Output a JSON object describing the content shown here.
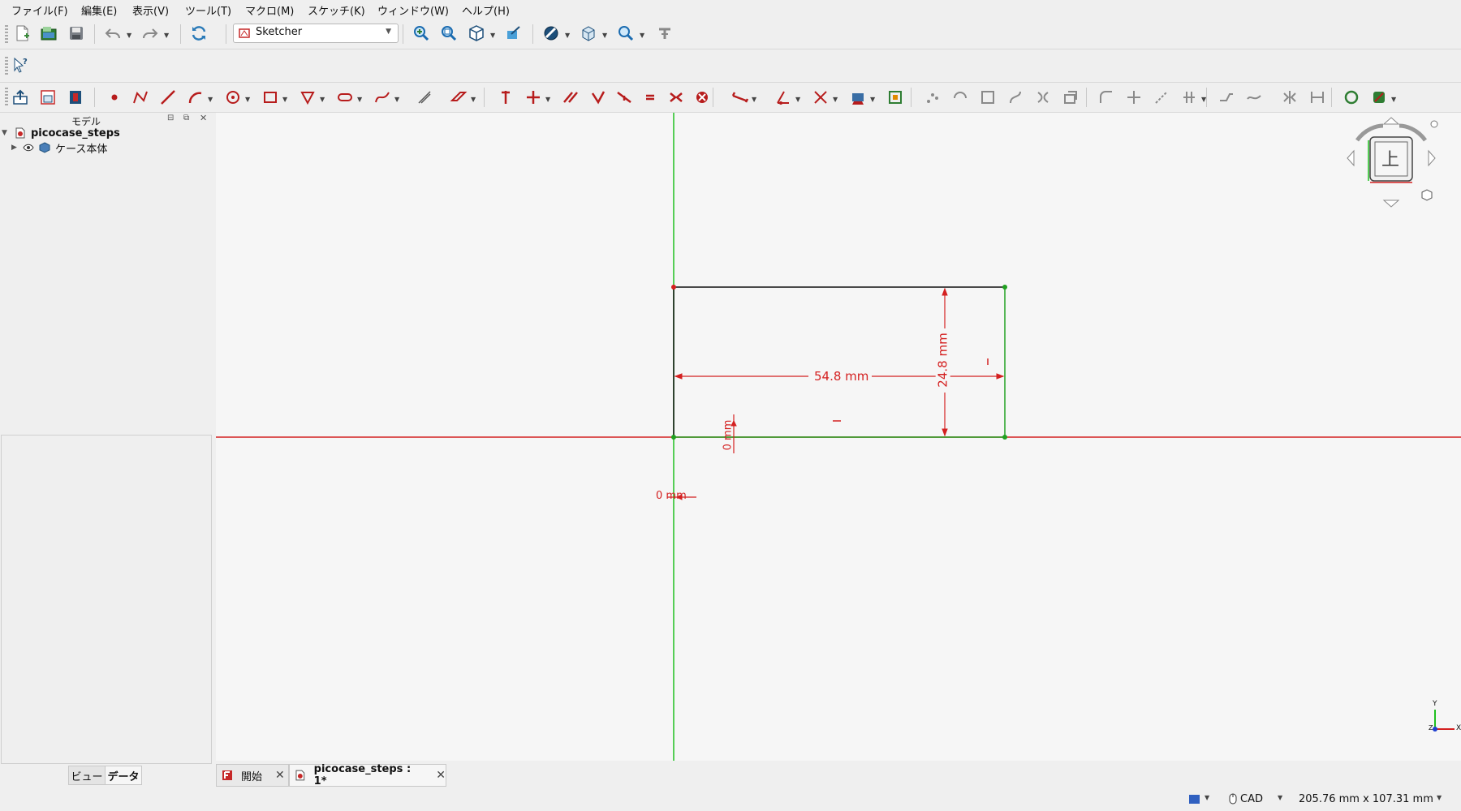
{
  "menu": [
    "ファイル(F)",
    "編集(E)",
    "表示(V)",
    "ツール(T)",
    "マクロ(M)",
    "スケッチ(K)",
    "ウィンドウ(W)",
    "ヘルプ(H)"
  ],
  "workbench": {
    "selected": "Sketcher"
  },
  "tree": {
    "title": "モデル",
    "document": "picocase_steps",
    "child": "ケース本体"
  },
  "panel_tabs": [
    "ビュー",
    "データ"
  ],
  "doc_tabs": [
    {
      "label": "開始"
    },
    {
      "label": "picocase_steps : 1*"
    }
  ],
  "sketch": {
    "width_label": "54.8 mm",
    "height_label": "24.8 mm",
    "origin_x_label": "0 mm",
    "origin_y_label": "0 mm"
  },
  "navcube": {
    "face": "上"
  },
  "axes": {
    "x": "X",
    "y": "Y",
    "z": "Z"
  },
  "status": {
    "nav_style": "CAD",
    "dimensions": "205.76 mm x 107.31 mm"
  },
  "colors": {
    "x_axis": "#d42020",
    "y_axis": "#20c020",
    "constraint": "#d42020",
    "geometry": "#111111",
    "fixed_geometry": "#20a020"
  }
}
